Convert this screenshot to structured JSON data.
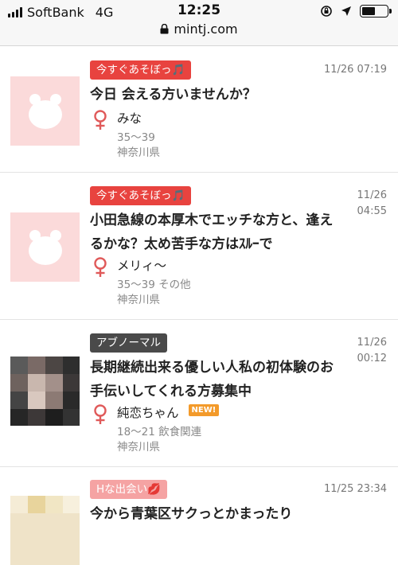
{
  "status": {
    "carrier": "SoftBank",
    "network": "4G",
    "time": "12:25",
    "battery_level": 0.55
  },
  "browser": {
    "url": "mintj.com"
  },
  "posts": [
    {
      "category": "今すぐあそぼっ🎵",
      "date": "11/26 07:19",
      "title": "今日 会える方いませんか？",
      "name": "みな",
      "age": "35〜39",
      "region": "神奈川県",
      "thumbnail": "placeholder-bear"
    },
    {
      "category": "今すぐあそぼっ🎵",
      "date_line1": "11/26",
      "date_line2": "04:55",
      "title_line1": "小田急線の本厚木でエッチな方と、逢え",
      "title_line2": "るかな？太め苦手な方はｽﾙｰで",
      "name": "メリィ〜",
      "age": "35〜39 その他",
      "region": "神奈川県",
      "thumbnail": "placeholder-bear"
    },
    {
      "category": "アブノーマル",
      "date_line1": "11/26",
      "date_line2": "00:12",
      "title_line1": "長期継続出来る優しい人私の初体験のお",
      "title_line2": "手伝いしてくれる方募集中",
      "name": "純恋ちゃん",
      "badge": "NEW!",
      "age": "18〜21 飲食関連",
      "region": "神奈川県",
      "thumbnail": "mosaic-photo"
    },
    {
      "category": "Hな出会い💋",
      "date": "11/25 23:34",
      "title": "今から青葉区サクっとかまったり",
      "thumbnail": "mosaic-photo"
    }
  ],
  "colors": {
    "tag_red": "#e8433f",
    "tag_dark": "#4a4a4a",
    "tag_pink": "#f5a3a3",
    "female_icon": "#e05a5a",
    "thumb_bg": "#fbdada"
  }
}
